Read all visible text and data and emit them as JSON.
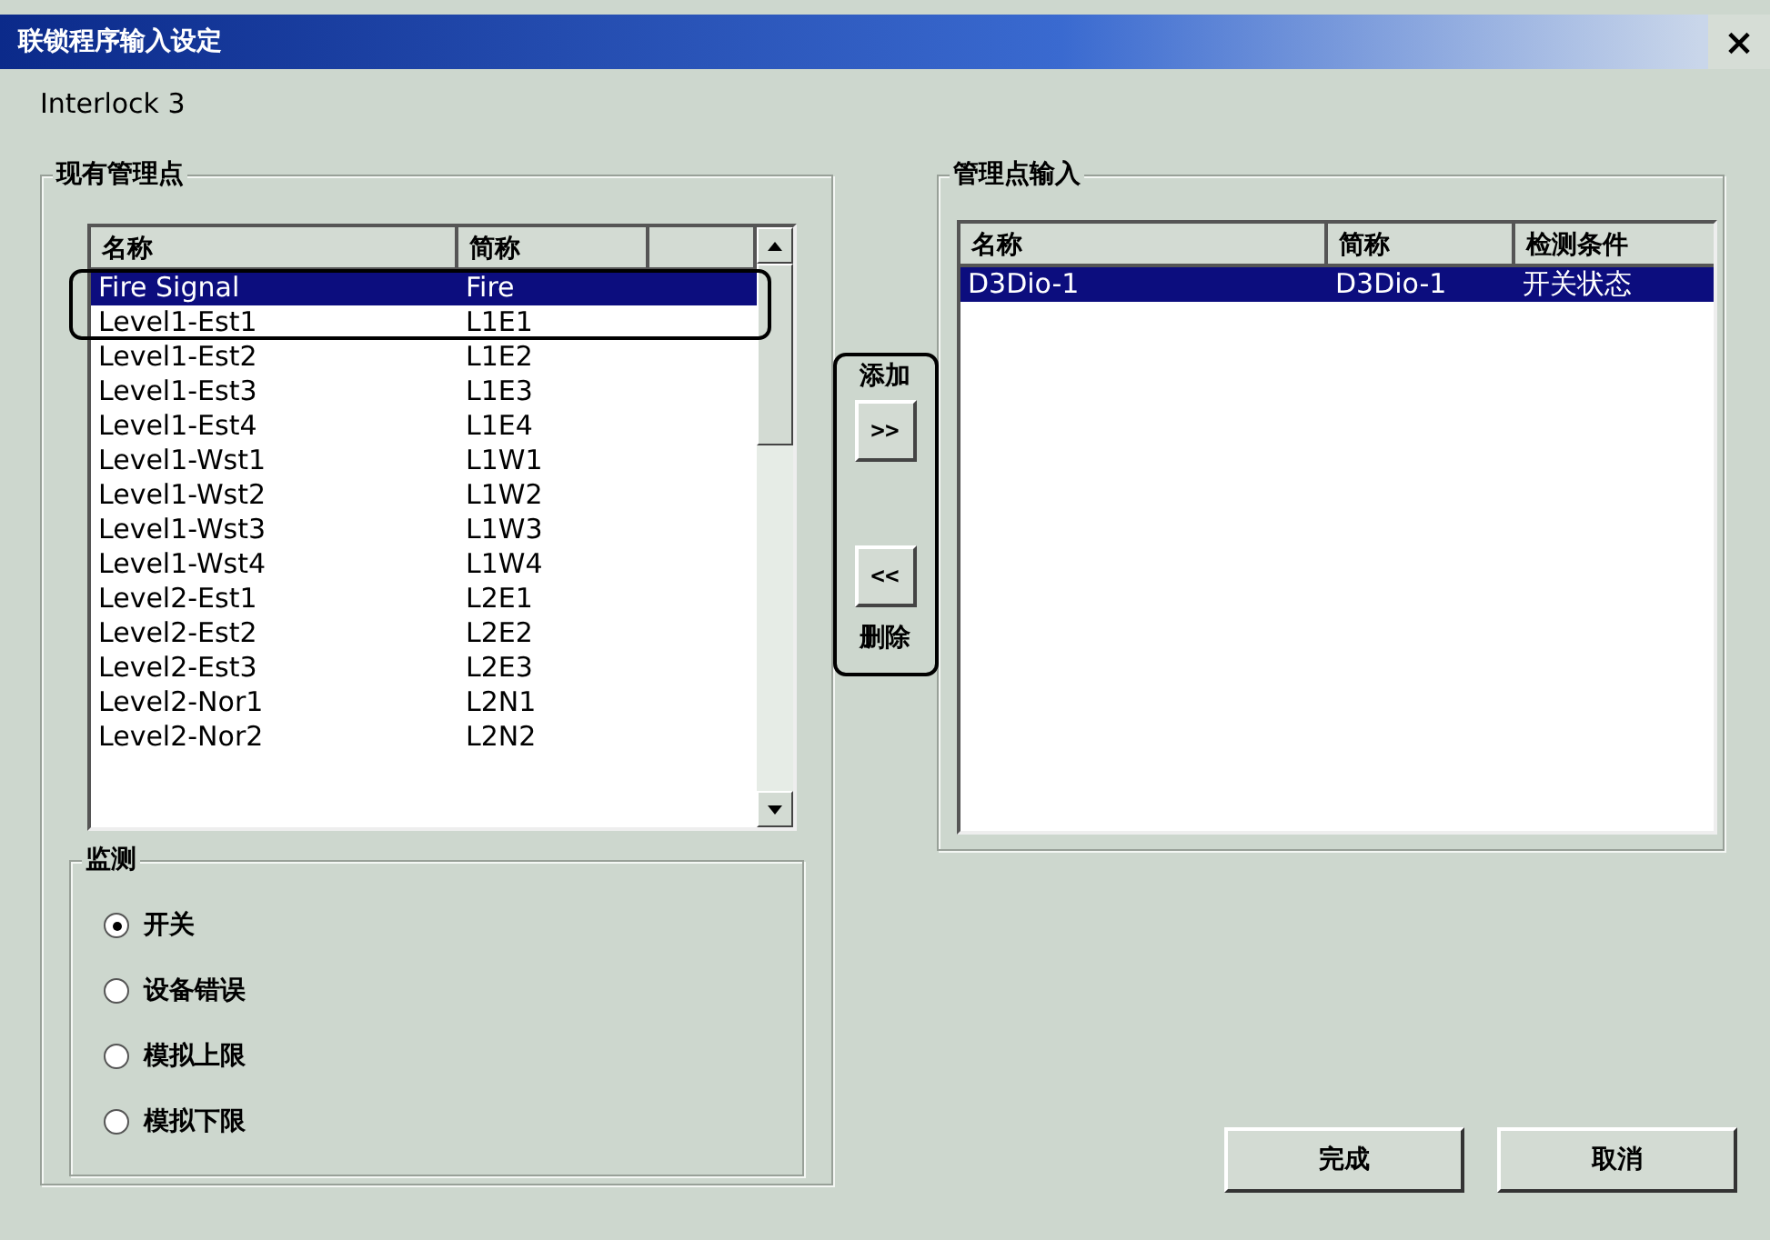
{
  "window": {
    "title": "联锁程序输入设定",
    "close": "×"
  },
  "subtitle": "Interlock 3",
  "existing_points": {
    "legend": "现有管理点",
    "columns": [
      "名称",
      "简称"
    ],
    "rows": [
      {
        "name": "Fire Signal",
        "short": "Fire",
        "selected": true
      },
      {
        "name": "Level1-Est1",
        "short": "L1E1",
        "selected": false
      },
      {
        "name": "Level1-Est2",
        "short": "L1E2",
        "selected": false
      },
      {
        "name": "Level1-Est3",
        "short": "L1E3",
        "selected": false
      },
      {
        "name": "Level1-Est4",
        "short": "L1E4",
        "selected": false
      },
      {
        "name": "Level1-Wst1",
        "short": "L1W1",
        "selected": false
      },
      {
        "name": "Level1-Wst2",
        "short": "L1W2",
        "selected": false
      },
      {
        "name": "Level1-Wst3",
        "short": "L1W3",
        "selected": false
      },
      {
        "name": "Level1-Wst4",
        "short": "L1W4",
        "selected": false
      },
      {
        "name": "Level2-Est1",
        "short": "L2E1",
        "selected": false
      },
      {
        "name": "Level2-Est2",
        "short": "L2E2",
        "selected": false
      },
      {
        "name": "Level2-Est3",
        "short": "L2E3",
        "selected": false
      },
      {
        "name": "Level2-Nor1",
        "short": "L2N1",
        "selected": false
      },
      {
        "name": "Level2-Nor2",
        "short": "L2N2",
        "selected": false
      }
    ]
  },
  "transfer": {
    "add_label": "添加",
    "add_button": ">>",
    "remove_button": "<<",
    "remove_label": "删除"
  },
  "input_points": {
    "legend": "管理点输入",
    "columns": [
      "名称",
      "简称",
      "检测条件"
    ],
    "rows": [
      {
        "name": "D3Dio-1",
        "short": "D3Dio-1",
        "condition": "开关状态",
        "selected": true
      }
    ]
  },
  "monitor": {
    "legend": "监测",
    "options": [
      {
        "label": "开关",
        "selected": true
      },
      {
        "label": "设备错误",
        "selected": false
      },
      {
        "label": "模拟上限",
        "selected": false
      },
      {
        "label": "模拟下限",
        "selected": false
      }
    ]
  },
  "buttons": [
    "完成",
    "取消"
  ]
}
